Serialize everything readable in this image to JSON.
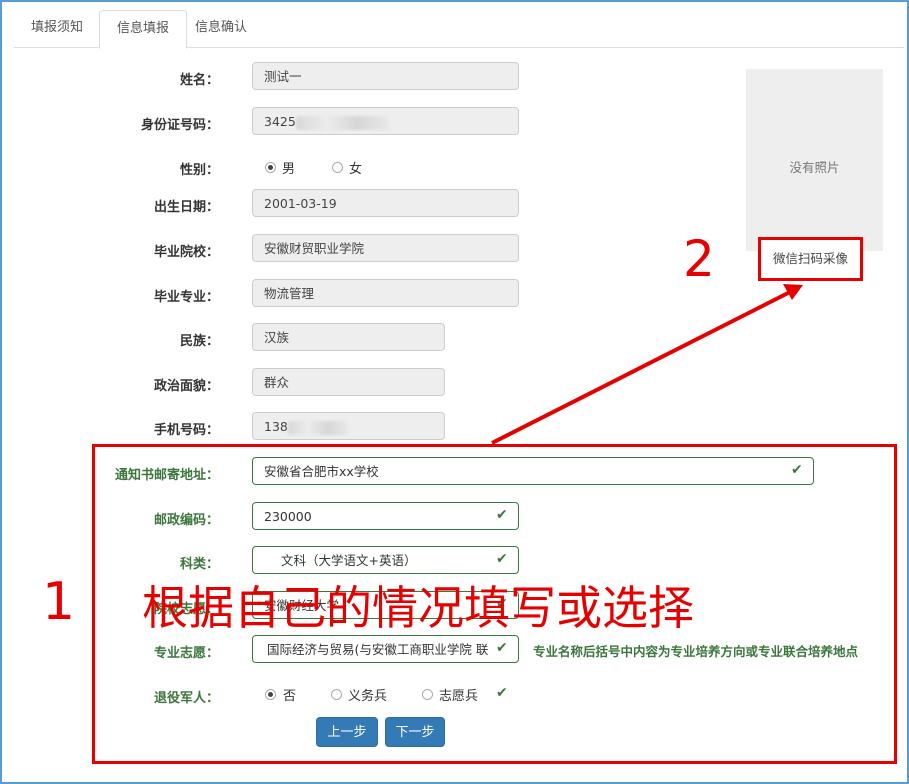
{
  "tabs": [
    "填报须知",
    "信息填报",
    "信息确认"
  ],
  "fields": {
    "name": {
      "label": "姓名：",
      "value": "测试一"
    },
    "id_number": {
      "label": "身份证号码：",
      "value_prefix": "3425"
    },
    "gender": {
      "label": "性别：",
      "options": [
        "男",
        "女"
      ],
      "selected": "男"
    },
    "birth_date": {
      "label": "出生日期：",
      "value": "2001-03-19"
    },
    "school": {
      "label": "毕业院校：",
      "value": "安徽财贸职业学院"
    },
    "major": {
      "label": "毕业专业：",
      "value": "物流管理"
    },
    "ethnicity": {
      "label": "民族：",
      "value": "汉族"
    },
    "political": {
      "label": "政治面貌：",
      "value": "群众"
    },
    "phone": {
      "label": "手机号码：",
      "value_prefix": "138"
    },
    "address": {
      "label": "通知书邮寄地址：",
      "value": "安徽省合肥市xx学校"
    },
    "postcode": {
      "label": "邮政编码：",
      "value": "230000"
    },
    "subject": {
      "label": "科类：",
      "value": "文科（大学语文+英语）"
    },
    "college_choice": {
      "label": "院校志愿：",
      "value": "安徽财经大学"
    },
    "major_choice": {
      "label": "专业志愿：",
      "value": "国际经济与贸易(与安徽工商职业学院 联",
      "hint": "专业名称后括号中内容为专业培养方向或专业联合培养地点"
    },
    "veteran": {
      "label": "退役军人：",
      "options": [
        "否",
        "义务兵",
        "志愿兵"
      ],
      "selected": "否"
    }
  },
  "photo": {
    "empty_text": "没有照片",
    "wechat_button": "微信扫码采像"
  },
  "buttons": {
    "prev": "上一步",
    "next": "下一步"
  },
  "annotations": {
    "num1": "1",
    "text1": "根据自己的情况填写或选择",
    "num2": "2"
  },
  "colors": {
    "annotation_red": "#e60000",
    "success_green": "#3c763d",
    "primary_blue": "#337ab7"
  }
}
